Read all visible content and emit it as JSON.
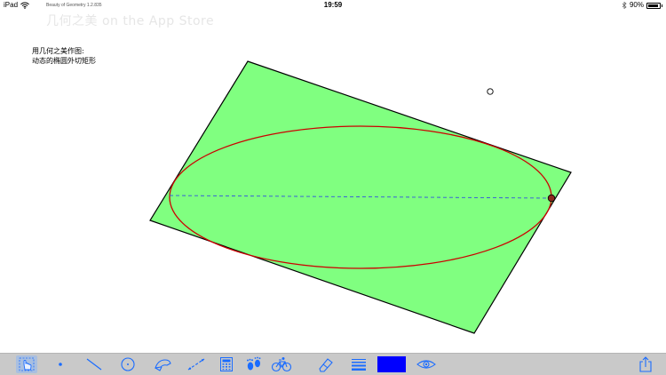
{
  "status_bar": {
    "device": "iPad",
    "app_name": "Beauty of Geometry 1.2.835",
    "time": "19:59",
    "battery": "90%",
    "battery_level": 0.9
  },
  "watermark": "几何之美 on the App Store",
  "caption": {
    "line1": "用几何之美作图:",
    "line2": "动态的椭圆外切矩形"
  },
  "colors": {
    "rectangle_fill": "#80ff80",
    "rectangle_stroke": "#000000",
    "ellipse_stroke": "#cc0000",
    "axis_line": "#3355dd",
    "tool_icon": "#1a6cff",
    "color_swatch": "#0000ff",
    "toolbar_bg": "#c9c9c9"
  },
  "toolbar": {
    "tools": [
      {
        "name": "select-hand-icon",
        "selected": true
      },
      {
        "name": "point-icon"
      },
      {
        "name": "line-segment-icon"
      },
      {
        "name": "circle-icon"
      },
      {
        "name": "compass-icon"
      },
      {
        "name": "dashed-line-icon"
      },
      {
        "name": "calculator-icon"
      },
      {
        "name": "footprints-icon"
      },
      {
        "name": "bicycle-icon"
      },
      {
        "name": "eraser-icon"
      },
      {
        "name": "line-style-icon"
      },
      {
        "name": "color-swatch"
      },
      {
        "name": "eye-icon"
      },
      {
        "name": "share-icon"
      }
    ]
  }
}
